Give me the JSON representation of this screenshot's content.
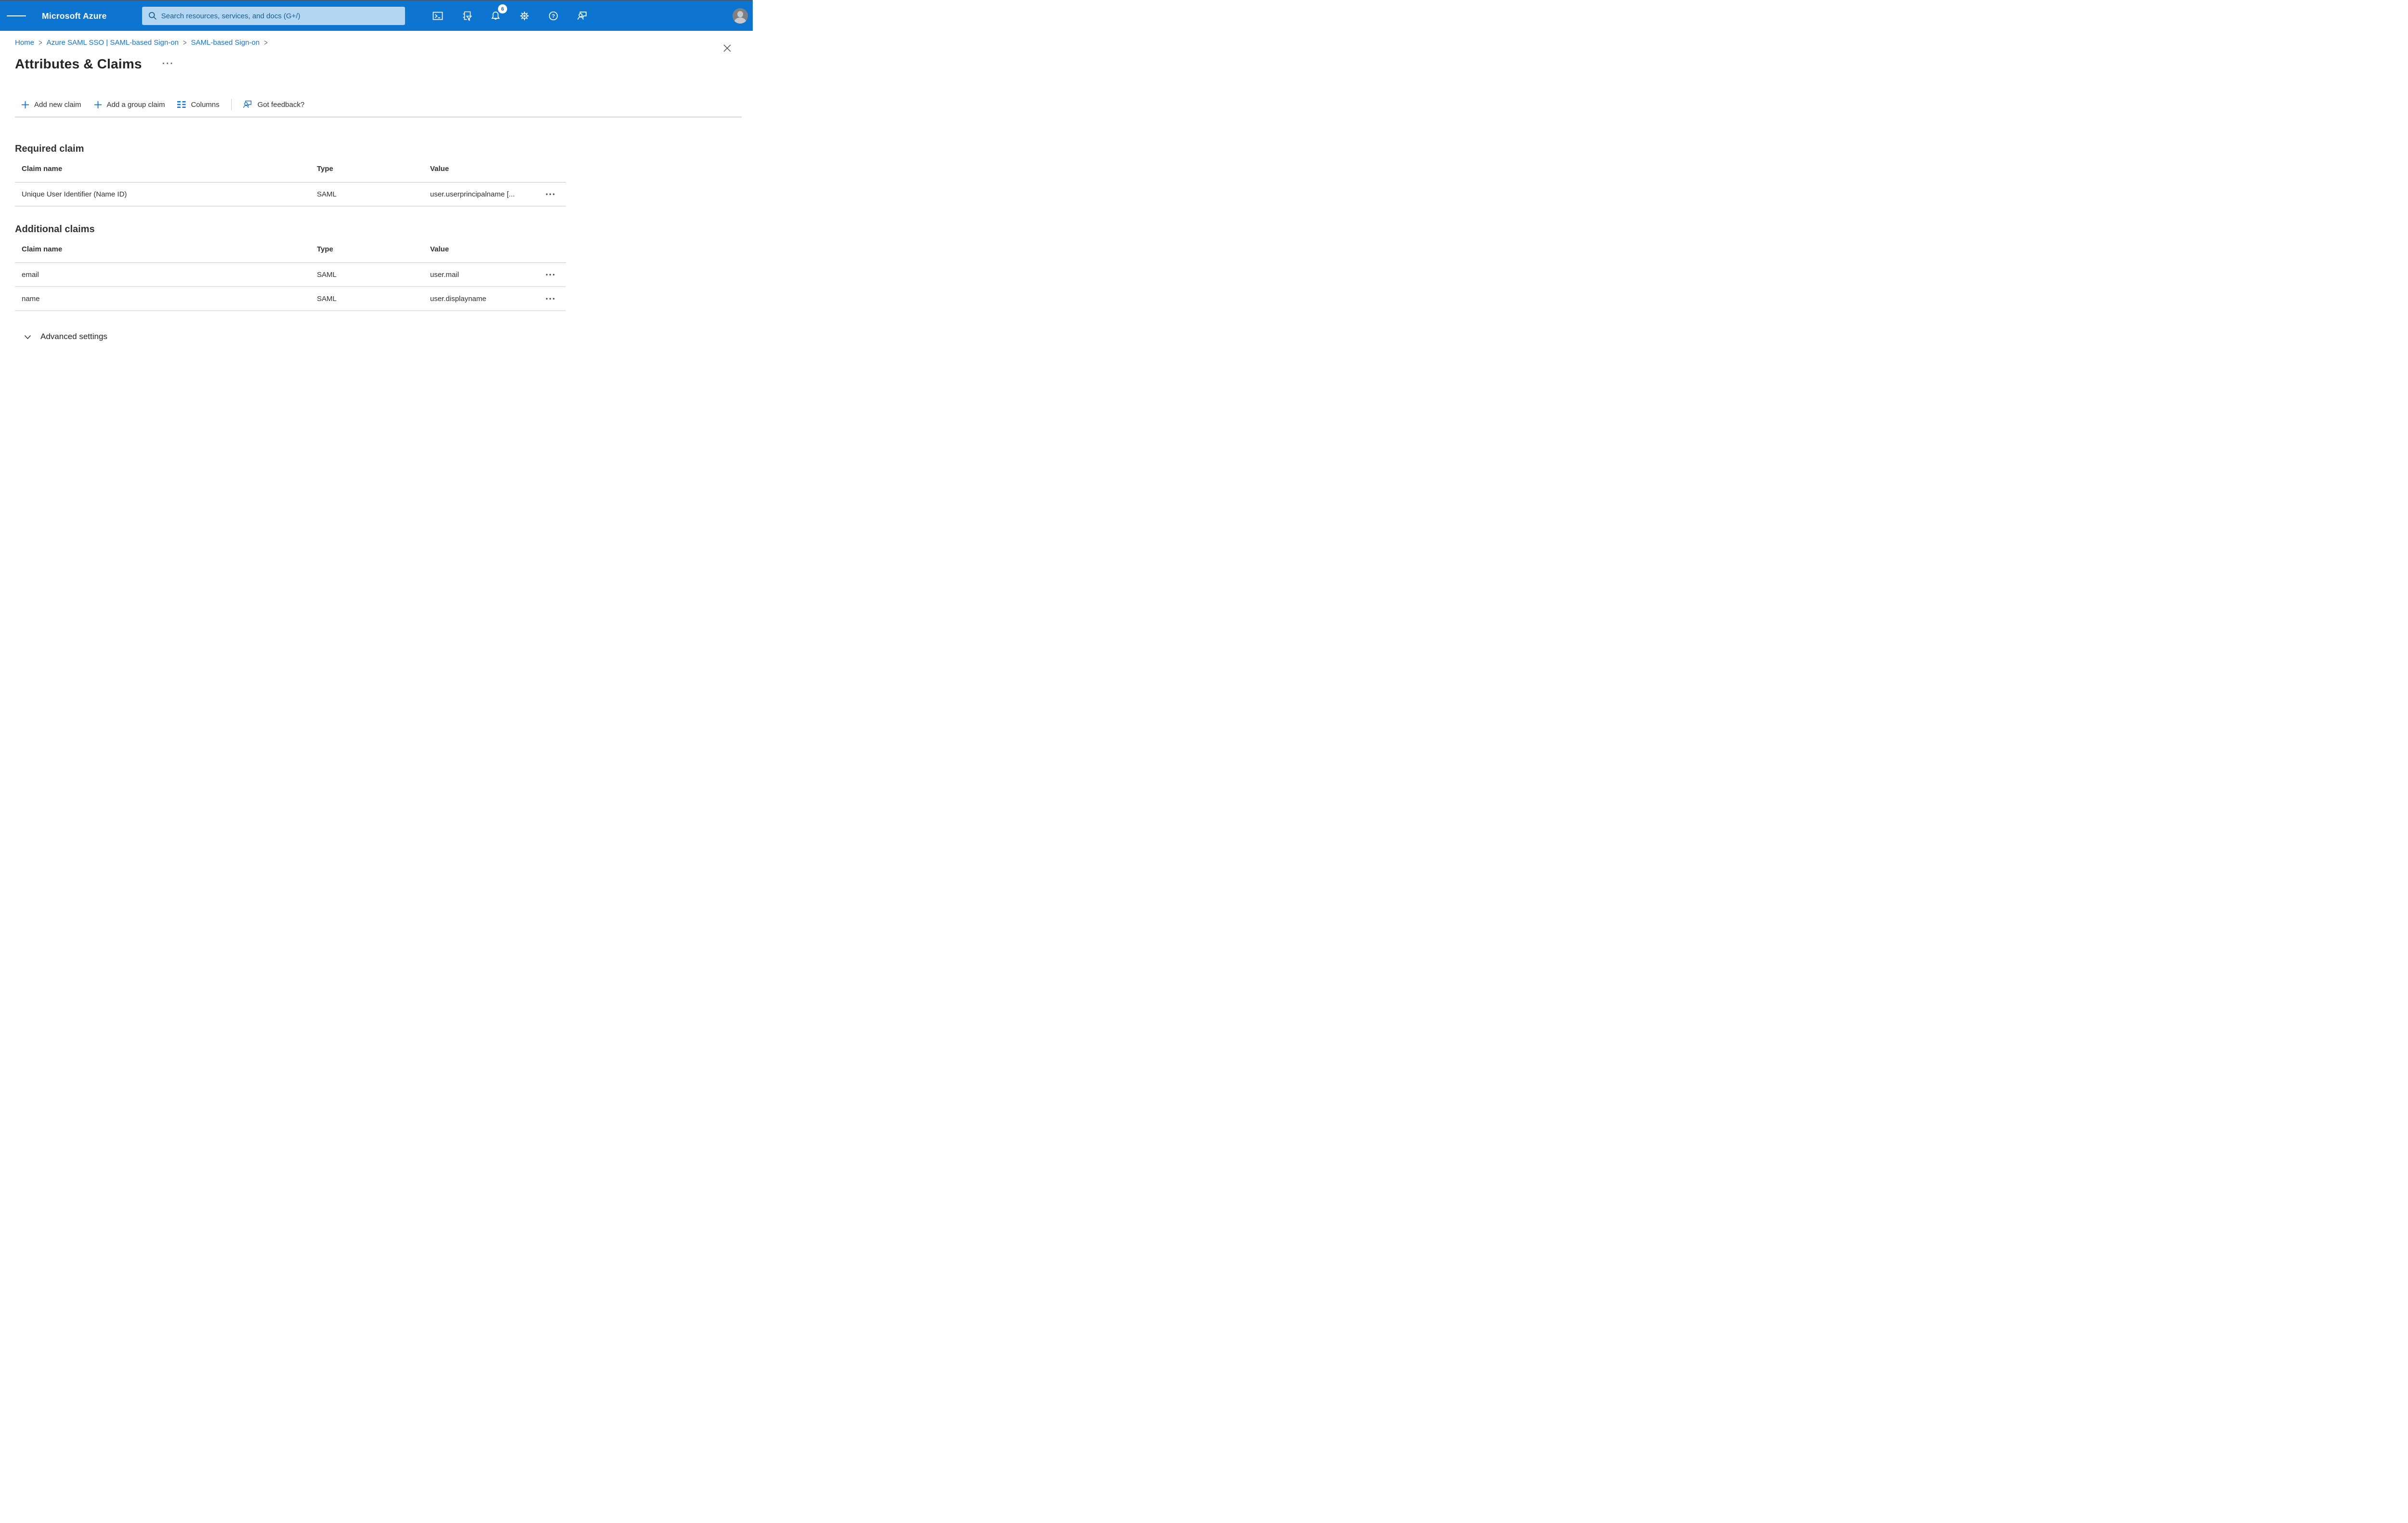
{
  "colors": {
    "topbar_blue": "#0d74cf",
    "search_bg": "#b3d7f3",
    "search_text": "#175a93",
    "link_blue": "#1273d4",
    "text_primary": "#323130",
    "divider_gray": "#d6d6d6"
  },
  "topbar": {
    "product": "Microsoft Azure",
    "search_placeholder": "Search resources, services, and docs (G+/)",
    "notification_count": "6"
  },
  "breadcrumb": {
    "separator": ">",
    "items": [
      {
        "label": "Home"
      },
      {
        "label": "Azure SAML SSO | SAML-based Sign-on"
      },
      {
        "label": "SAML-based Sign-on"
      }
    ]
  },
  "page": {
    "title": "Attributes & Claims",
    "title_menu": "···",
    "row_menu": "•••"
  },
  "toolbar": {
    "items": [
      {
        "label": "Add new claim"
      },
      {
        "label": "Add a group claim"
      },
      {
        "label": "Columns"
      },
      {
        "label": "Got feedback?"
      }
    ]
  },
  "required_claim": {
    "heading": "Required claim",
    "columns": [
      "Claim name",
      "Type",
      "Value"
    ],
    "rows": [
      {
        "claim_name": "Unique User Identifier (Name ID)",
        "type": "SAML",
        "value": "user.userprincipalname [..."
      }
    ]
  },
  "additional_claims": {
    "heading": "Additional claims",
    "columns": [
      "Claim name",
      "Type",
      "Value"
    ],
    "rows": [
      {
        "claim_name": "email",
        "type": "SAML",
        "value": "user.mail"
      },
      {
        "claim_name": "name",
        "type": "SAML",
        "value": "user.displayname"
      }
    ]
  },
  "advanced_settings": {
    "label": "Advanced settings"
  }
}
